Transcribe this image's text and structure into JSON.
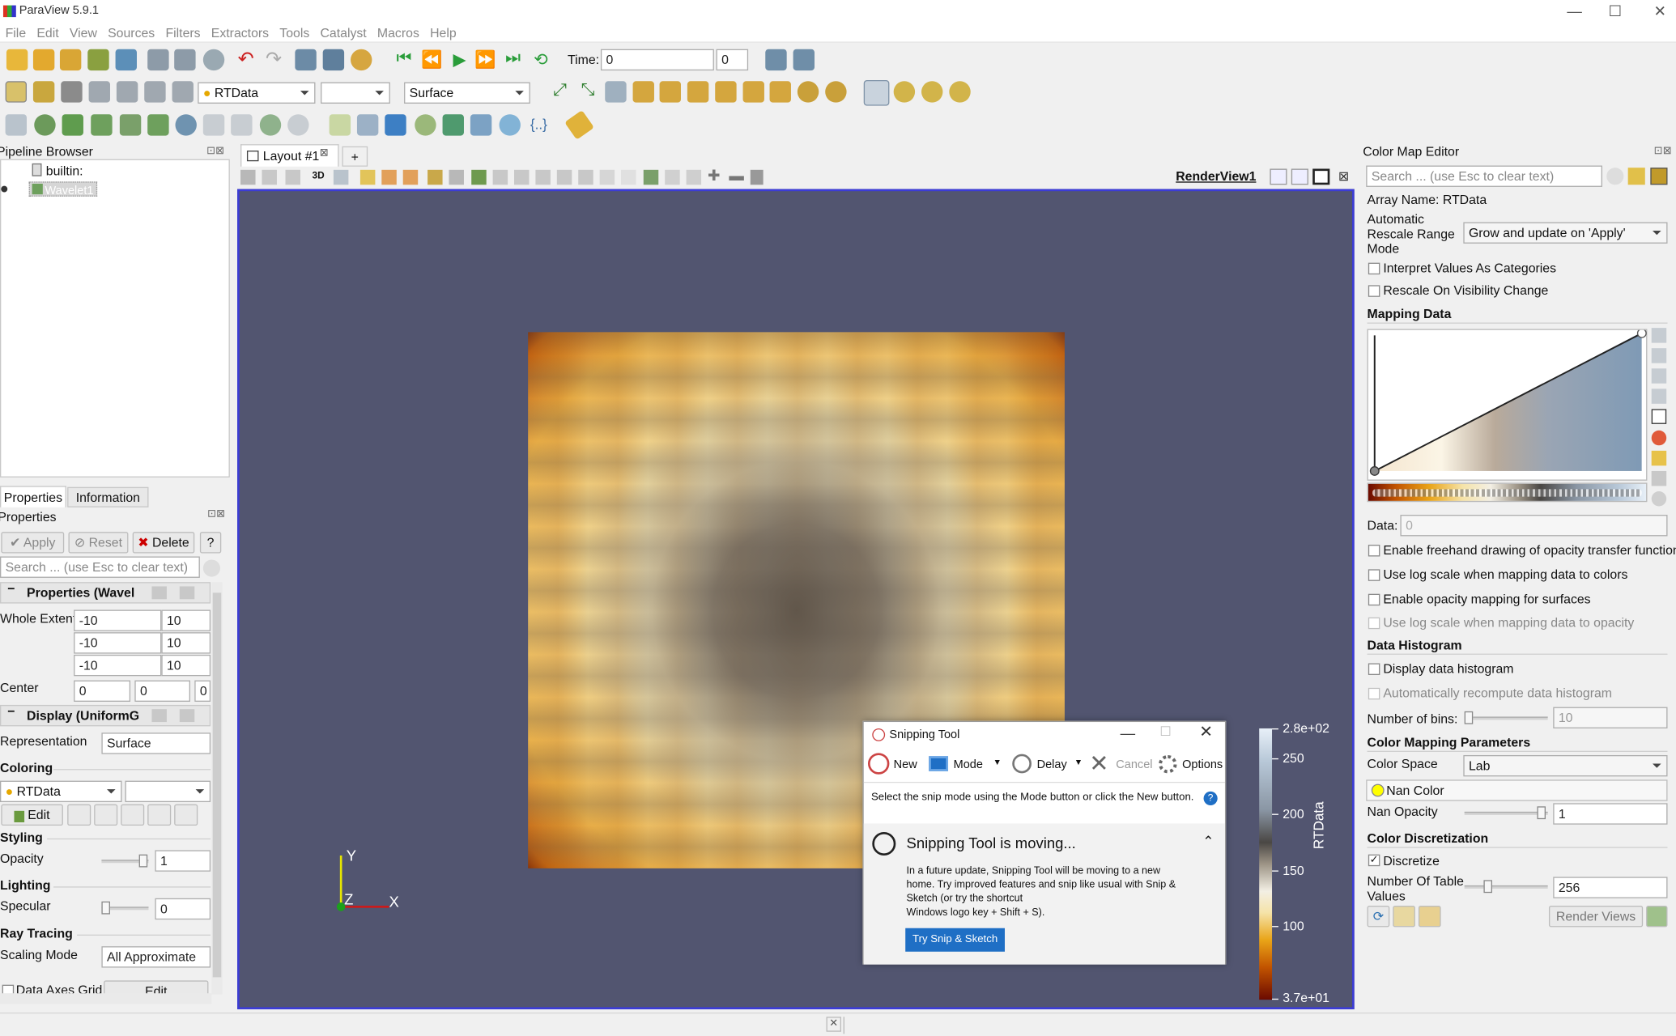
{
  "window": {
    "title": "ParaView 5.9.1",
    "minimize": "—",
    "maximize": "☐",
    "close": "✕"
  },
  "menu": [
    "File",
    "Edit",
    "View",
    "Sources",
    "Filters",
    "Extractors",
    "Tools",
    "Catalyst",
    "Macros",
    "Help"
  ],
  "toolbar": {
    "time_label": "Time:",
    "time_value": "0",
    "time_index": "0",
    "array_select": "RTData",
    "component_select": "",
    "representation_select": "Surface"
  },
  "pipeline": {
    "title": "Pipeline Browser",
    "builtin": "builtin:",
    "source": "Wavelet1"
  },
  "tabs": {
    "properties": "Properties",
    "information": "Information"
  },
  "properties": {
    "title": "Properties",
    "apply": "Apply",
    "reset": "Reset",
    "delete": "Delete",
    "help": "?",
    "search_placeholder": "Search ... (use Esc to clear text)",
    "section_props": "Properties (Wavel",
    "whole_extent_label": "Whole Extent",
    "extent": [
      [
        "-10",
        "10"
      ],
      [
        "-10",
        "10"
      ],
      [
        "-10",
        "10"
      ]
    ],
    "center_label": "Center",
    "center": [
      "0",
      "0",
      "0"
    ],
    "section_display": "Display (UniformG",
    "representation_label": "Representation",
    "representation": "Surface",
    "coloring_label": "Coloring",
    "coloring_array": "RTData",
    "edit": "Edit",
    "styling_label": "Styling",
    "opacity_label": "Opacity",
    "opacity": "1",
    "lighting_label": "Lighting",
    "specular_label": "Specular",
    "specular": "0",
    "raytracing_label": "Ray Tracing",
    "scaling_label": "Scaling Mode",
    "scaling": "All Approximate",
    "axes_grid_label": "Data Axes Grid",
    "axes_grid_edit": "Edit"
  },
  "layout": {
    "tab": "Layout #1",
    "add": "+",
    "view_name": "RenderView1",
    "mode_3d": "3D"
  },
  "axes": {
    "y": "Y",
    "z": "Z",
    "x": "X"
  },
  "colorbar": {
    "title": "RTData",
    "ticks": [
      "2.8e+02",
      "250",
      "200",
      "150",
      "100",
      "3.7e+01"
    ]
  },
  "snipping": {
    "title": "Snipping Tool",
    "new": "New",
    "mode": "Mode",
    "delay": "Delay",
    "cancel": "Cancel",
    "options": "Options",
    "instructions": "Select the snip mode using the Mode button or click the New button.",
    "heading": "Snipping Tool is moving...",
    "body": "In a future update, Snipping Tool will be moving to a new home. Try improved features and snip like usual with Snip & Sketch (or try the shortcut",
    "body2": "Windows logo key + Shift + S).",
    "cta": "Try Snip & Sketch"
  },
  "cme": {
    "title": "Color Map Editor",
    "search_placeholder": "Search ... (use Esc to clear text)",
    "array_name": "Array Name: RTData",
    "rescale_label": [
      "Automatic",
      "Rescale Range",
      "Mode"
    ],
    "rescale_value": "Grow and update on 'Apply'",
    "interpret": "Interpret Values As Categories",
    "rescale_visibility": "Rescale On Visibility Change",
    "mapping_data": "Mapping Data",
    "data_label": "Data:",
    "data_value": "0",
    "freehand": "Enable freehand drawing of opacity transfer function",
    "logscale": "Use log scale when mapping data to colors",
    "opacity_surfaces": "Enable opacity mapping for surfaces",
    "log_opacity": "Use log scale when mapping data to opacity",
    "histogram": "Data Histogram",
    "display_hist": "Display data histogram",
    "auto_hist": "Automatically recompute data histogram",
    "bins_label": "Number of bins:",
    "bins": "10",
    "cmp": "Color Mapping Parameters",
    "color_space_label": "Color Space",
    "color_space": "Lab",
    "nan_color": "Nan Color",
    "nan_opacity_label": "Nan Opacity",
    "nan_opacity": "1",
    "discretization": "Color Discretization",
    "discretize": "Discretize",
    "table_values_label": [
      "Number Of Table",
      "Values"
    ],
    "table_values": "256",
    "render_views": "Render Views"
  },
  "colors": {
    "accent": "#1f6fc5",
    "view_bg": "#525570",
    "view_border": "#3c3cd6"
  }
}
